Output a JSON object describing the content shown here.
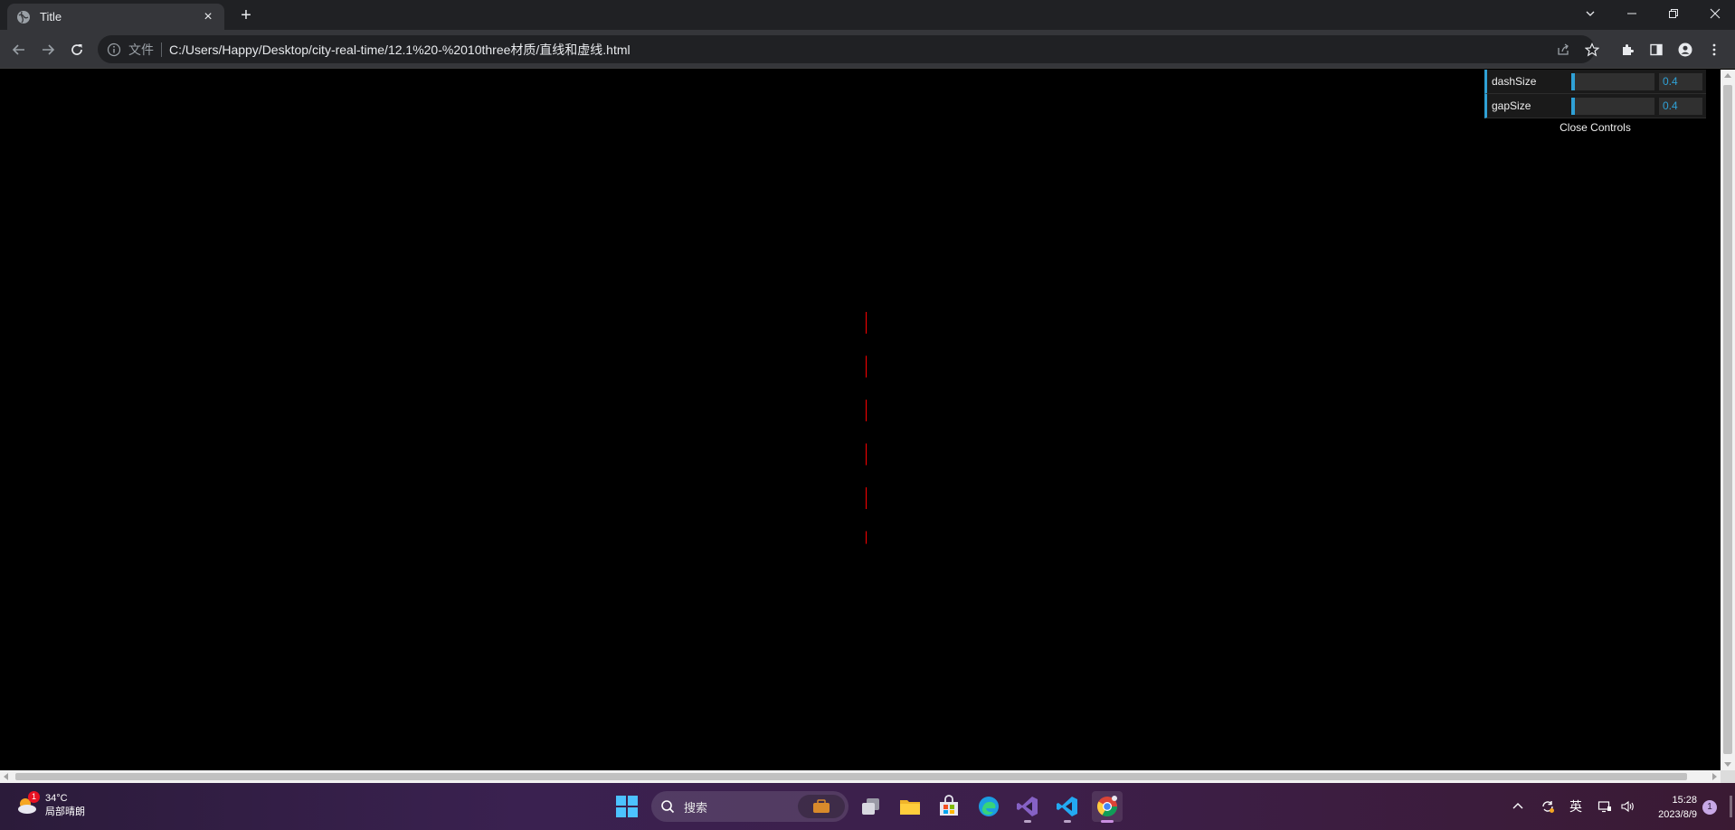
{
  "browser": {
    "tab_title": "Title",
    "scheme_label": "文件",
    "url": "C:/Users/Happy/Desktop/city-real-time/12.1%20-%2010three材质/直线和虚线.html"
  },
  "gui": {
    "controls": [
      {
        "label": "dashSize",
        "value": "0.4",
        "fraction": 0.04
      },
      {
        "label": "gapSize",
        "value": "0.4",
        "fraction": 0.04
      }
    ],
    "close_label": "Close Controls"
  },
  "scene": {
    "background_color": "#000000",
    "line_color": "#ff0000",
    "dash_count": 6
  },
  "taskbar": {
    "weather_temp": "34°C",
    "weather_desc": "局部晴朗",
    "weather_badge": "1",
    "search_placeholder": "搜索",
    "ime_label": "英",
    "time": "15:28",
    "date": "2023/8/9",
    "notification_count": "1",
    "apps": [
      "task-view",
      "file-explorer",
      "microsoft-store",
      "edge",
      "visual-studio",
      "vscode",
      "chrome"
    ]
  },
  "colors": {
    "gui_accent": "#2fa1d6",
    "chrome_bg": "#202124",
    "toolbar_bg": "#35363a"
  }
}
